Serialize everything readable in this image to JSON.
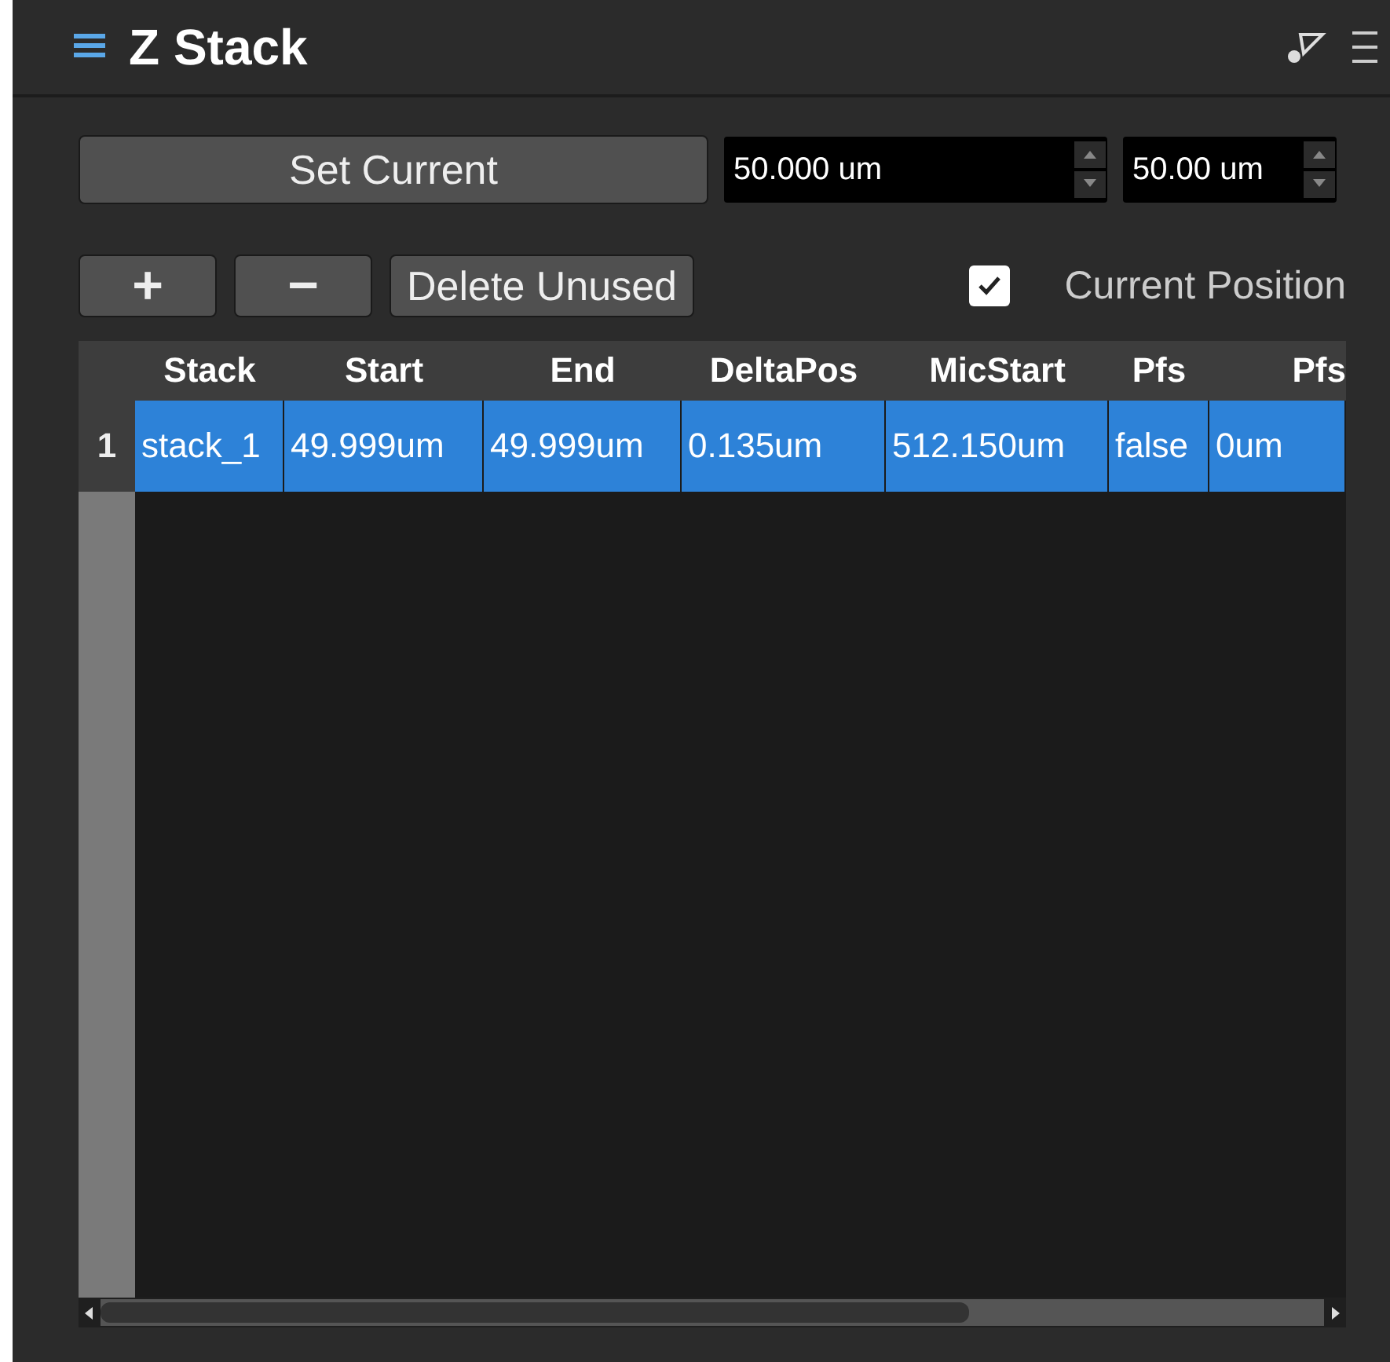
{
  "window": {
    "title": "Z Stack"
  },
  "set_current_button": "Set Current",
  "spinboxes": [
    {
      "value": "50.000 um"
    },
    {
      "value": "50.00 um"
    }
  ],
  "buttons": [
    "+",
    "−",
    "Delete Unused"
  ],
  "current_position": {
    "label": "Current Position",
    "checked": true
  },
  "table": {
    "columns": [
      "Stack",
      "Start",
      "End",
      "DeltaPos",
      "MicStart",
      "Pfs",
      "Pfs"
    ],
    "rows": [
      {
        "number": "1",
        "selected": true,
        "cells": [
          "stack_1",
          "49.999um",
          "49.999um",
          "0.135um",
          "512.150um",
          "false",
          "0um"
        ]
      }
    ]
  }
}
